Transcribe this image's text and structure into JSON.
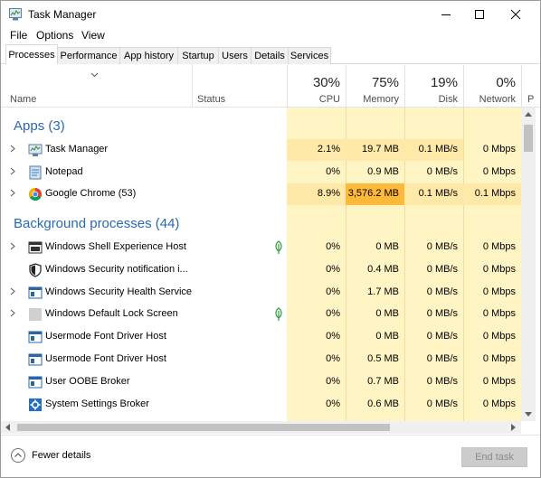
{
  "window": {
    "title": "Task Manager"
  },
  "menu": [
    "File",
    "Options",
    "View"
  ],
  "tabs": [
    "Processes",
    "Performance",
    "App history",
    "Startup",
    "Users",
    "Details",
    "Services"
  ],
  "active_tab": "Processes",
  "columns": {
    "name": "Name",
    "status": "Status",
    "cpu": {
      "label": "CPU",
      "pct": "30%"
    },
    "memory": {
      "label": "Memory",
      "pct": "75%"
    },
    "disk": {
      "label": "Disk",
      "pct": "19%"
    },
    "network": {
      "label": "Network",
      "pct": "0%"
    },
    "overflow": {
      "label": "P"
    }
  },
  "groups": {
    "apps": "Apps (3)",
    "background": "Background processes (44)"
  },
  "apps": [
    {
      "name": "Task Manager",
      "icon": "task-manager-icon",
      "expandable": true,
      "cpu": "2.1%",
      "memory": "19.7 MB",
      "disk": "0.1 MB/s",
      "network": "0 Mbps"
    },
    {
      "name": "Notepad",
      "icon": "notepad-icon",
      "expandable": true,
      "cpu": "0%",
      "memory": "0.9 MB",
      "disk": "0 MB/s",
      "network": "0 Mbps"
    },
    {
      "name": "Google Chrome (53)",
      "icon": "chrome-icon",
      "expandable": true,
      "cpu": "8.9%",
      "memory": "3,576.2 MB",
      "disk": "0.1 MB/s",
      "network": "0.1 Mbps"
    }
  ],
  "background": [
    {
      "name": "Windows Shell Experience Host",
      "icon": "app-window-icon",
      "expandable": true,
      "suspended": true,
      "cpu": "0%",
      "memory": "0 MB",
      "disk": "0 MB/s",
      "network": "0 Mbps"
    },
    {
      "name": "Windows Security notification i...",
      "icon": "shield-icon",
      "expandable": false,
      "suspended": false,
      "cpu": "0%",
      "memory": "0.4 MB",
      "disk": "0 MB/s",
      "network": "0 Mbps"
    },
    {
      "name": "Windows Security Health Service",
      "icon": "service-window-icon",
      "expandable": true,
      "suspended": false,
      "cpu": "0%",
      "memory": "1.7 MB",
      "disk": "0 MB/s",
      "network": "0 Mbps"
    },
    {
      "name": "Windows Default Lock Screen",
      "icon": "blank-app-icon",
      "expandable": true,
      "suspended": true,
      "cpu": "0%",
      "memory": "0 MB",
      "disk": "0 MB/s",
      "network": "0 Mbps"
    },
    {
      "name": "Usermode Font Driver Host",
      "icon": "service-window-icon",
      "expandable": false,
      "suspended": false,
      "cpu": "0%",
      "memory": "0 MB",
      "disk": "0 MB/s",
      "network": "0 Mbps"
    },
    {
      "name": "Usermode Font Driver Host",
      "icon": "service-window-icon",
      "expandable": false,
      "suspended": false,
      "cpu": "0%",
      "memory": "0.5 MB",
      "disk": "0 MB/s",
      "network": "0 Mbps"
    },
    {
      "name": "User OOBE Broker",
      "icon": "service-window-icon",
      "expandable": false,
      "suspended": false,
      "cpu": "0%",
      "memory": "0.7 MB",
      "disk": "0 MB/s",
      "network": "0 Mbps"
    },
    {
      "name": "System Settings Broker",
      "icon": "settings-gear-icon",
      "expandable": false,
      "suspended": false,
      "cpu": "0%",
      "memory": "0.6 MB",
      "disk": "0 MB/s",
      "network": "0 Mbps"
    }
  ],
  "footer": {
    "fewer_details": "Fewer details",
    "end_task": "End task"
  },
  "colors": {
    "heat_light": "#fff4c4",
    "heat_medium": "#ffe9a8",
    "heat_high": "#ffb939",
    "group_text": "#2a69b2"
  }
}
